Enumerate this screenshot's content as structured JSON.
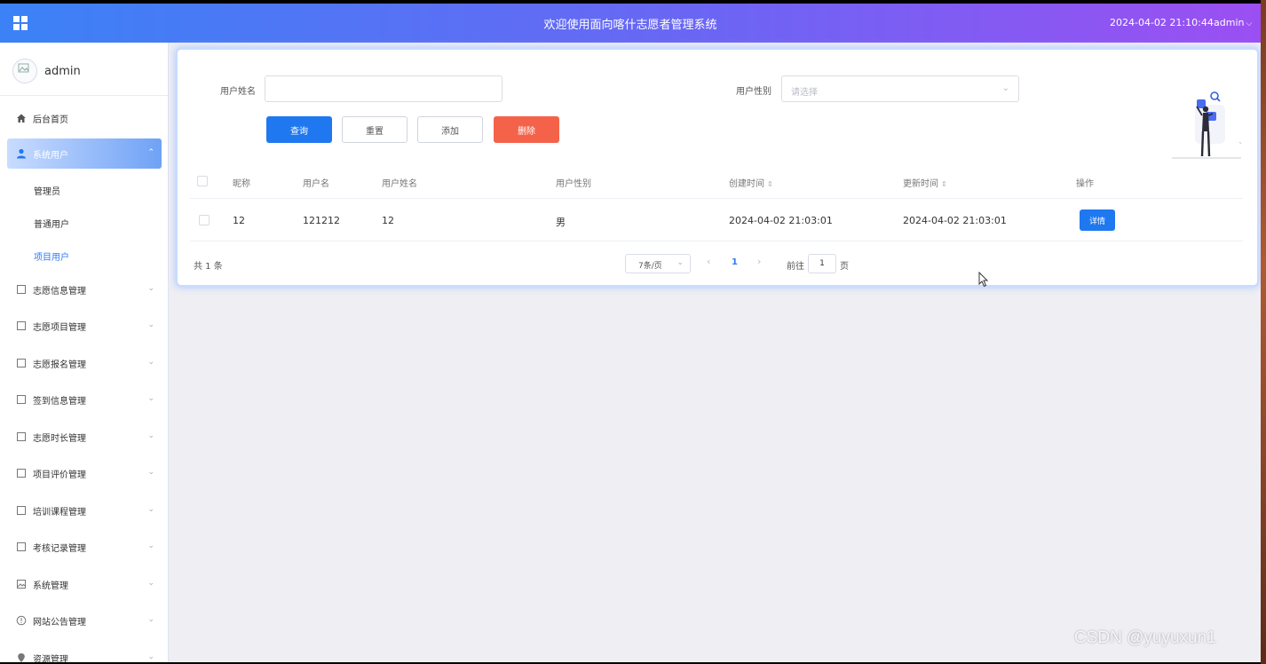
{
  "header": {
    "title": "欢迎使用面向喀什志愿者管理系统",
    "datetime": "2024-04-02 21:10:44",
    "user": "admin"
  },
  "sidebar": {
    "profile_name": "admin",
    "items": [
      {
        "label": "后台首页",
        "icon": "home-icon"
      },
      {
        "label": "系统用户",
        "icon": "user-icon",
        "active": true
      },
      {
        "label": "志愿信息管理",
        "icon": "doc-icon"
      },
      {
        "label": "志愿项目管理",
        "icon": "doc-icon"
      },
      {
        "label": "志愿报名管理",
        "icon": "doc-icon"
      },
      {
        "label": "签到信息管理",
        "icon": "doc-icon"
      },
      {
        "label": "志愿时长管理",
        "icon": "doc-icon"
      },
      {
        "label": "项目评价管理",
        "icon": "doc-icon"
      },
      {
        "label": "培训课程管理",
        "icon": "doc-icon"
      },
      {
        "label": "考核记录管理",
        "icon": "doc-icon"
      },
      {
        "label": "系统管理",
        "icon": "image-icon"
      },
      {
        "label": "网站公告管理",
        "icon": "info-icon"
      },
      {
        "label": "资源管理",
        "icon": "pin-icon"
      }
    ],
    "subitems": [
      {
        "label": "管理员"
      },
      {
        "label": "普通用户"
      },
      {
        "label": "项目用户",
        "current": true
      }
    ]
  },
  "search": {
    "name_label": "用户姓名",
    "name_value": "",
    "gender_label": "用户性别",
    "gender_placeholder": "请选择"
  },
  "buttons": {
    "query": "查询",
    "reset": "重置",
    "add": "添加",
    "delete": "删除"
  },
  "table": {
    "columns": [
      "昵称",
      "用户名",
      "用户姓名",
      "用户性别",
      "创建时间",
      "更新时间",
      "操作"
    ],
    "rows": [
      {
        "nickname": "12",
        "username": "121212",
        "realname": "12",
        "gender": "男",
        "created": "2024-04-02 21:03:01",
        "updated": "2024-04-02 21:03:01",
        "action": "详情"
      }
    ]
  },
  "pagination": {
    "total_text": "共 1 条",
    "page_size": "7条/页",
    "current_page": "1",
    "goto_label": "前往",
    "goto_value": "1",
    "goto_suffix": "页"
  },
  "watermark": "CSDN @yuyuxun1",
  "colors": {
    "primary": "#1f78f0",
    "danger": "#f5624a",
    "header_start": "#3b82f6",
    "header_end": "#9b4ff2"
  }
}
